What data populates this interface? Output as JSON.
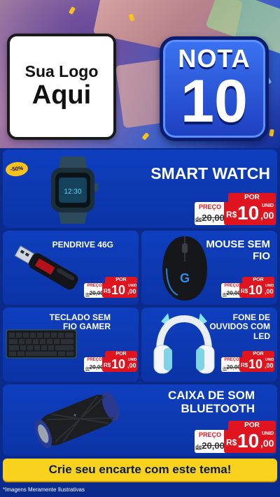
{
  "header": {
    "logo_line1": "Sua Logo",
    "logo_line2": "Aqui",
    "badge_top": "NOTA",
    "badge_number": "10"
  },
  "discount_badge": "-50%",
  "products": [
    {
      "name": "SMART WATCH",
      "por": "POR",
      "preco": "PREÇO",
      "old_prefix": "de",
      "old_price": "20,00",
      "currency": "R$",
      "price_int": "10",
      "price_cents": ",00",
      "unit": "UNID"
    },
    {
      "name": "PENDRIVE 46G",
      "por": "POR",
      "preco": "PREÇO",
      "old_prefix": "de",
      "old_price": "20,00",
      "currency": "R$",
      "price_int": "10",
      "price_cents": ",00",
      "unit": "UNID"
    },
    {
      "name": "MOUSE SEM FIO",
      "por": "POR",
      "preco": "PREÇO",
      "old_prefix": "de",
      "old_price": "20,00",
      "currency": "R$",
      "price_int": "10",
      "price_cents": ",00",
      "unit": "UNID"
    },
    {
      "name": "TECLADO SEM FIO GAMER",
      "por": "POR",
      "preco": "PREÇO",
      "old_prefix": "de",
      "old_price": "20,00",
      "currency": "R$",
      "price_int": "10",
      "price_cents": ",00",
      "unit": "UNID"
    },
    {
      "name": "FONE DE OUVIDOS COM LED",
      "por": "POR",
      "preco": "PREÇO",
      "old_prefix": "de",
      "old_price": "20,00",
      "currency": "R$",
      "price_int": "10",
      "price_cents": ",00",
      "unit": "UNID"
    },
    {
      "name": "CAIXA DE SOM BLUETOOTH",
      "por": "POR",
      "preco": "PREÇO",
      "old_prefix": "de",
      "old_price": "20,00",
      "currency": "R$",
      "price_int": "10",
      "price_cents": ",00",
      "unit": "UNID"
    }
  ],
  "cta": "Crie seu encarte com este tema!",
  "footer_note": "*Imagens Meramente Ilustrativas",
  "colors": {
    "primary_blue": "#0f3fbe",
    "accent_yellow": "#f8d21d",
    "price_red": "#e0141e"
  }
}
